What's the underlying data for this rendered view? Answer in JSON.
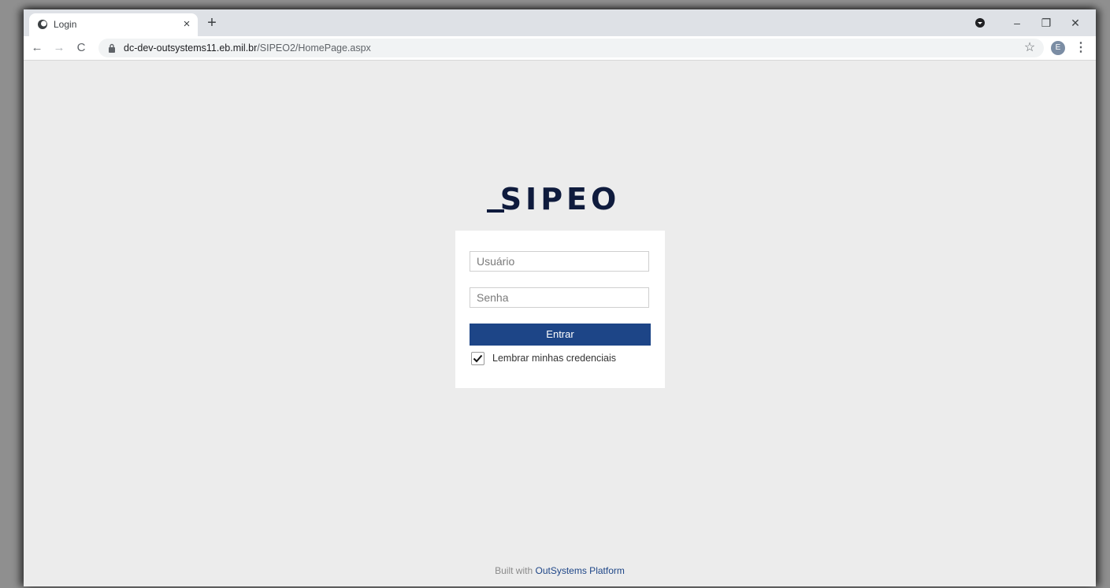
{
  "browser": {
    "tab": {
      "title": "Login",
      "close_glyph": "×"
    },
    "new_tab_glyph": "+",
    "window_controls": {
      "minimize": "–",
      "restore": "❐",
      "close": "✕"
    },
    "nav": {
      "back": "←",
      "forward": "→",
      "reload": "C"
    },
    "url": {
      "host": "dc-dev-outsystems11.eb.mil.br",
      "path": "/SIPEO2/HomePage.aspx"
    },
    "star_glyph": "☆",
    "avatar_letter": "E",
    "menu_glyph": "⋮"
  },
  "page": {
    "logo_text": "SIPEO",
    "username": {
      "placeholder": "Usuário",
      "value": ""
    },
    "password": {
      "placeholder": "Senha",
      "value": ""
    },
    "submit_label": "Entrar",
    "remember": {
      "label": "Lembrar minhas credenciais",
      "checked": true
    },
    "footer": {
      "prefix": "Built with",
      "link": "OutSystems Platform"
    }
  },
  "colors": {
    "accent": "#1d4587",
    "logo": "#0f1b3d",
    "page_background": "#ececec"
  },
  "icons": [
    "globe-favicon-icon",
    "lock-icon",
    "star-icon",
    "kebab-menu-icon",
    "checkmark-icon",
    "profile-menu-icon"
  ]
}
